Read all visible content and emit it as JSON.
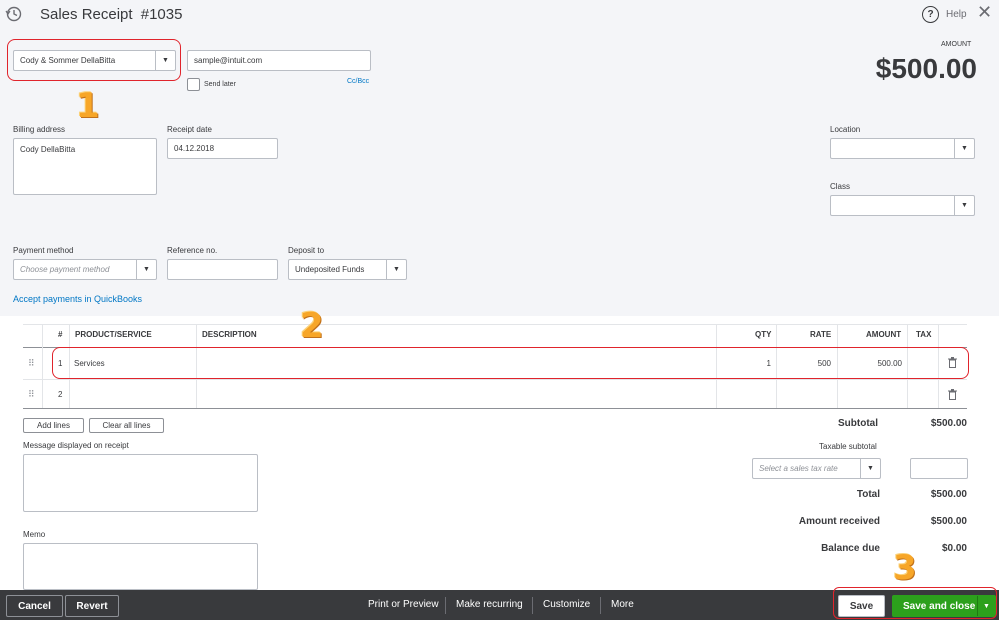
{
  "header": {
    "title": "Sales Receipt",
    "number": "#1035",
    "help_label": "Help",
    "close_symbol": "✕",
    "history_icon": "history-icon",
    "help_icon": "question-circle-icon",
    "close_icon": "close-icon"
  },
  "customer": {
    "value": "Cody & Sommer DellaBitta"
  },
  "email": {
    "value": "sample@intuit.com",
    "send_later_label": "Send later",
    "cc_bcc_label": "Cc/Bcc"
  },
  "amount": {
    "label": "AMOUNT",
    "value": "$500.00"
  },
  "billing": {
    "label": "Billing address",
    "value": "Cody DellaBitta"
  },
  "receipt_date": {
    "label": "Receipt date",
    "value": "04.12.2018"
  },
  "location": {
    "label": "Location",
    "value": ""
  },
  "class_field": {
    "label": "Class",
    "value": ""
  },
  "payment_method": {
    "label": "Payment method",
    "placeholder": "Choose payment method"
  },
  "reference": {
    "label": "Reference no.",
    "value": ""
  },
  "deposit_to": {
    "label": "Deposit to",
    "value": "Undeposited Funds"
  },
  "accept_payments_link": "Accept payments in QuickBooks",
  "table": {
    "headers": {
      "num": "#",
      "product": "PRODUCT/SERVICE",
      "description": "DESCRIPTION",
      "qty": "QTY",
      "rate": "RATE",
      "amount": "AMOUNT",
      "tax": "TAX"
    },
    "rows": [
      {
        "num": "1",
        "product": "Services",
        "description": "",
        "qty": "1",
        "rate": "500",
        "amount": "500.00"
      },
      {
        "num": "2",
        "product": "",
        "description": "",
        "qty": "",
        "rate": "",
        "amount": ""
      }
    ],
    "drag_icon": "drag-handle-icon",
    "delete_icon": "trash-icon"
  },
  "line_buttons": {
    "add": "Add lines",
    "clear": "Clear all lines"
  },
  "message": {
    "label": "Message displayed on receipt"
  },
  "memo": {
    "label": "Memo"
  },
  "summary": {
    "subtotal_label": "Subtotal",
    "subtotal_value": "$500.00",
    "taxable_label": "Taxable subtotal",
    "tax_rate_placeholder": "Select a sales tax rate",
    "total_label": "Total",
    "total_value": "$500.00",
    "received_label": "Amount received",
    "received_value": "$500.00",
    "balance_label": "Balance due",
    "balance_value": "$0.00"
  },
  "annotations": {
    "one": "1",
    "two": "2",
    "three": "3",
    "highlight_color": "#e0242c",
    "number_color": "#f7a628"
  },
  "footer": {
    "cancel": "Cancel",
    "revert": "Revert",
    "print": "Print or Preview",
    "recurring": "Make recurring",
    "customize": "Customize",
    "more": "More",
    "save": "Save",
    "save_close": "Save and close",
    "accent": "#2ca01c"
  }
}
